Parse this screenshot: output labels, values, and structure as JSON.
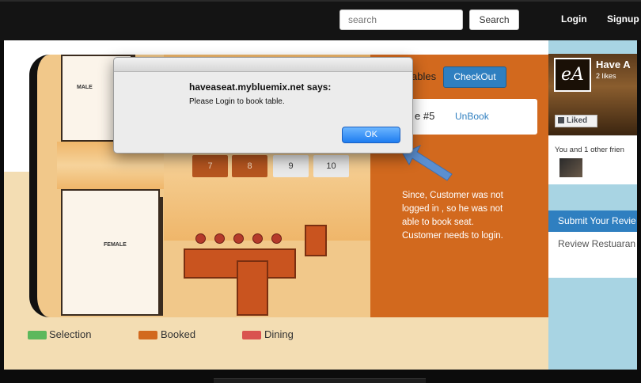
{
  "header": {
    "search_placeholder": "search",
    "search_button": "Search",
    "login": "Login",
    "signup": "Signup"
  },
  "tables": {
    "numbers": [
      "7",
      "8",
      "9",
      "10"
    ],
    "states": [
      "booked",
      "booked",
      "free",
      "free"
    ]
  },
  "panel": {
    "tables_label": "ables",
    "checkout": "CheckOut",
    "booked_label": "e  #5",
    "unbook": "UnBook",
    "note": "Since, Customer was not logged in , so he was not able to book seat. Customer needs to login."
  },
  "legend": [
    {
      "label": "Selection",
      "color": "#5cb85c"
    },
    {
      "label": "Booked",
      "color": "#d2691e"
    },
    {
      "label": "Dining",
      "color": "#d9534f"
    }
  ],
  "facebook": {
    "logo": "eA",
    "name": "Have A",
    "likes": "2 likes",
    "liked": "Liked",
    "friends": "You and 1 other frien"
  },
  "review": {
    "header": "Submit Your Revie",
    "link": "Review Restuaran"
  },
  "dialog": {
    "title": "haveaseat.mybluemix.net says:",
    "message": "Please Login to book table.",
    "ok": "OK"
  }
}
